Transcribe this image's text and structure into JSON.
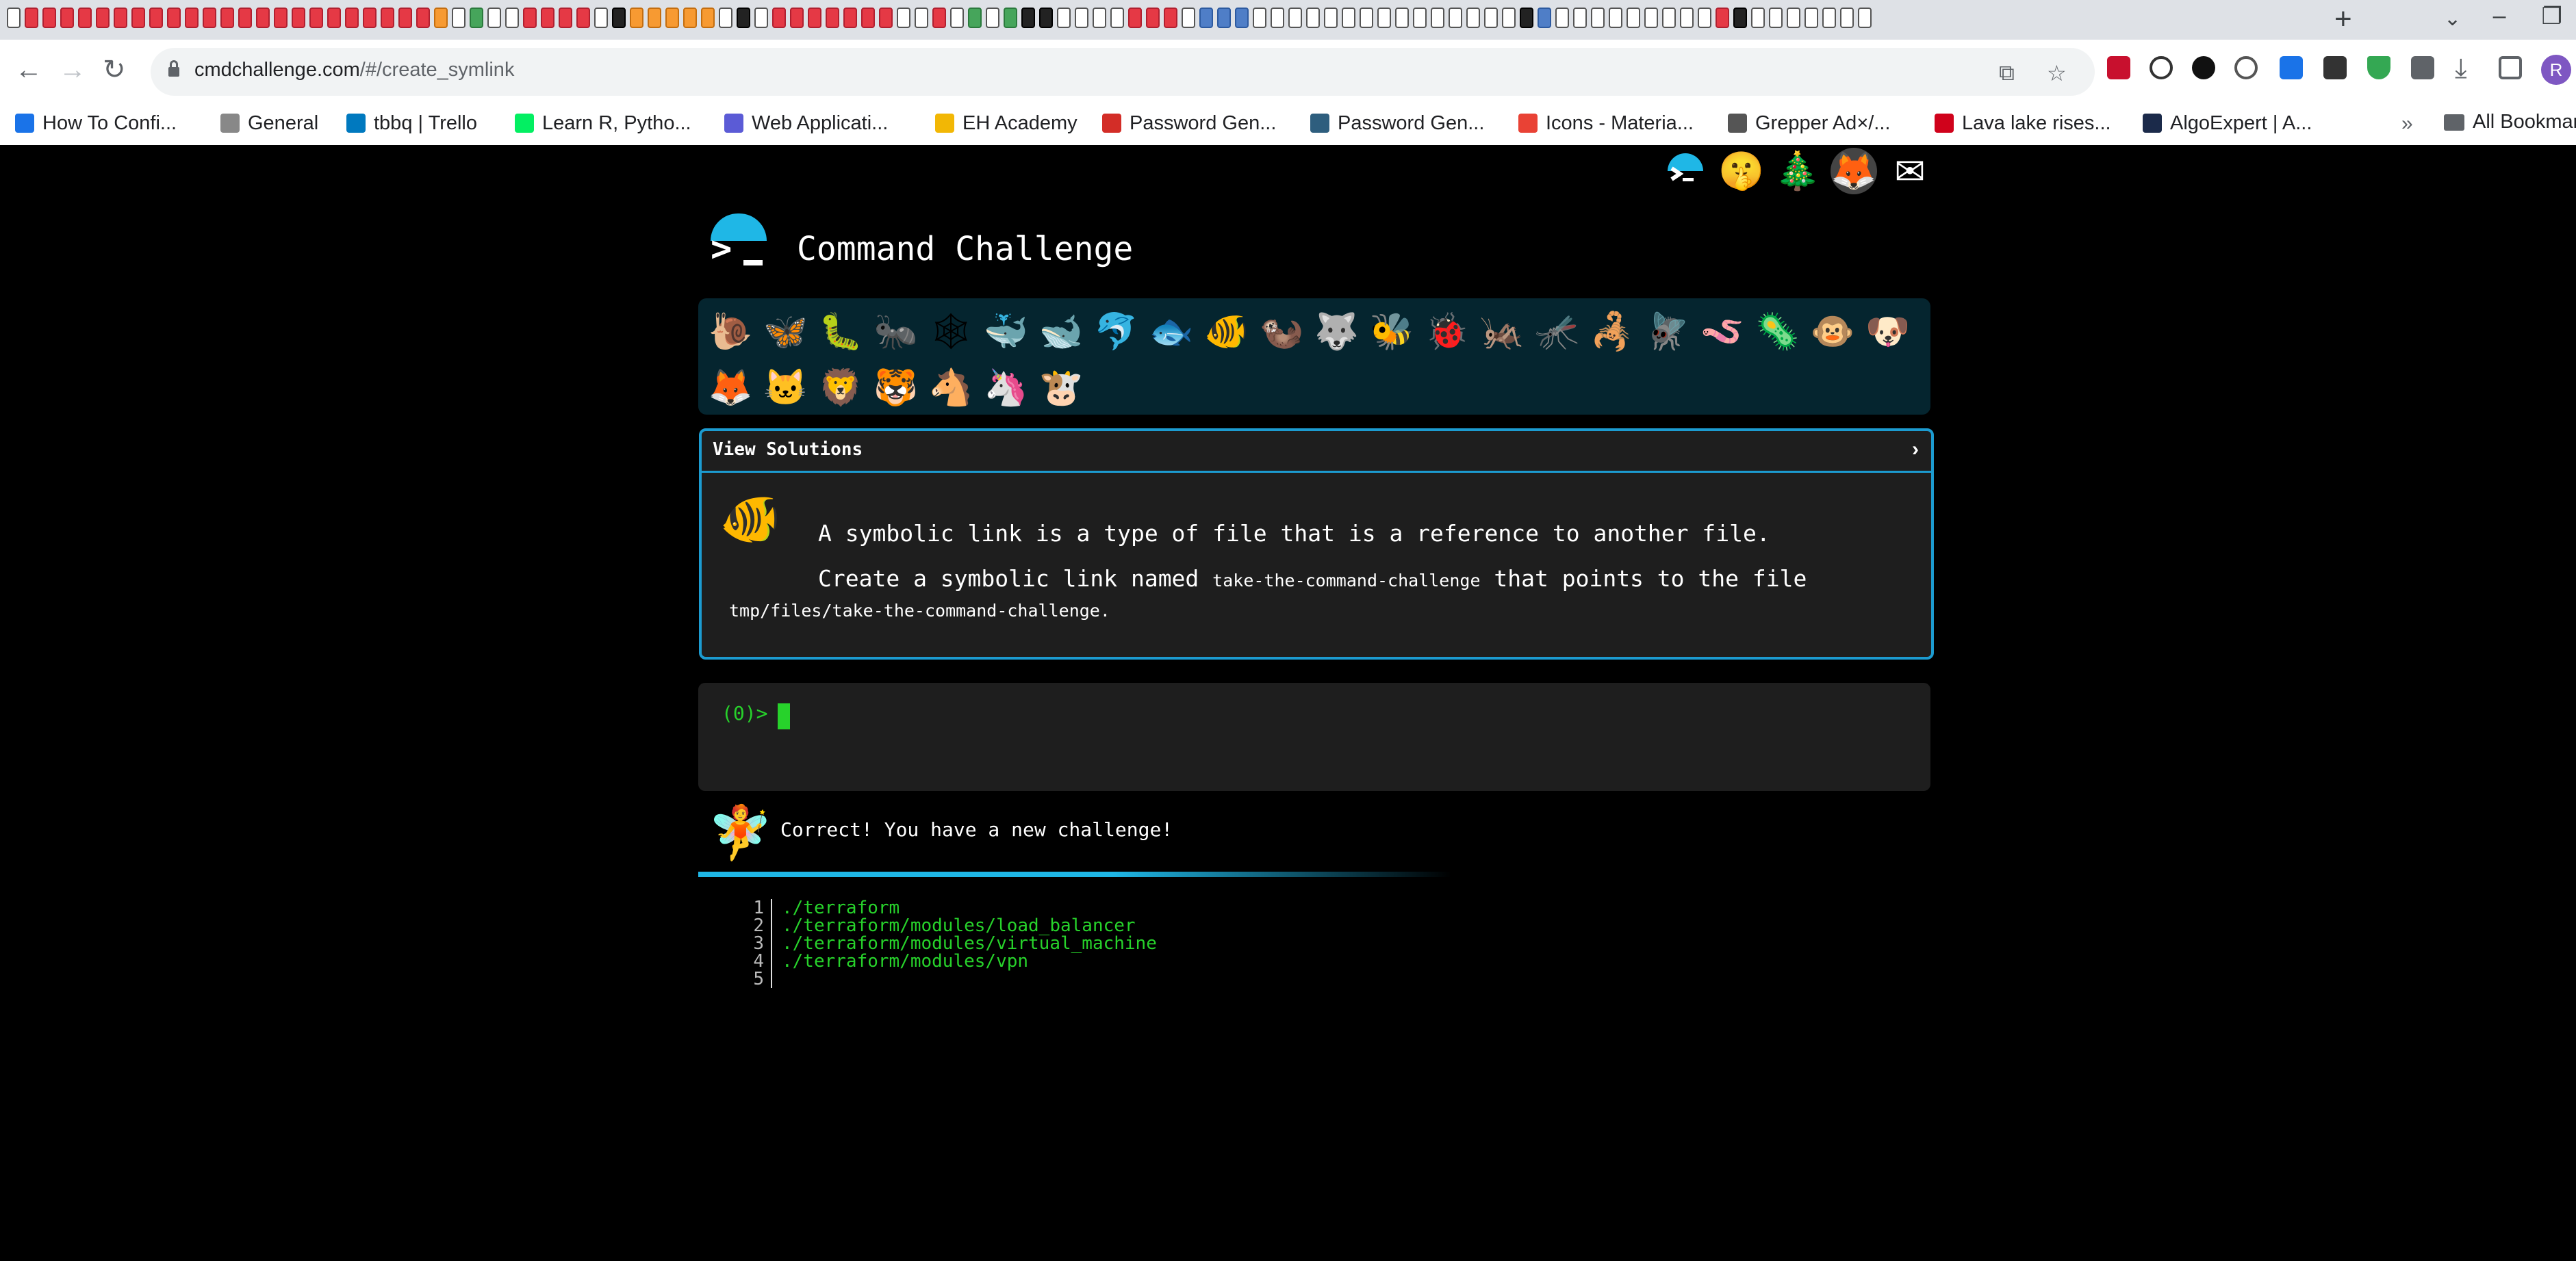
{
  "browser": {
    "url_host": "cmdchallenge.com",
    "url_path": "/#/create_symlink",
    "profile_initial": "R",
    "bookmarks": [
      {
        "label": "How To Confi...",
        "icon": "im-favicon",
        "color": "#1a73e8"
      },
      {
        "label": "General",
        "icon": "gears-favicon",
        "color": "#888888"
      },
      {
        "label": "tbbq | Trello",
        "icon": "trello-favicon",
        "color": "#0079bf"
      },
      {
        "label": "Learn R, Pytho...",
        "icon": "datacamp-favicon",
        "color": "#03ef62"
      },
      {
        "label": "Web Applicati...",
        "icon": "terminal-favicon",
        "color": "#5b5bd6"
      },
      {
        "label": "EH Academy",
        "icon": "eh-favicon",
        "color": "#f2b705"
      },
      {
        "label": "Password Gen...",
        "icon": "lastpass-favicon",
        "color": "#d32d27"
      },
      {
        "label": "Password Gen...",
        "icon": "bars-favicon",
        "color": "#2e5e7e"
      },
      {
        "label": "Icons - Materia...",
        "icon": "material-favicon",
        "color": "#e94235"
      },
      {
        "label": "Grepper Ad×/...",
        "icon": "globe-favicon",
        "color": "#555555"
      },
      {
        "label": "Lava lake rises...",
        "icon": "s-favicon",
        "color": "#d0021b"
      },
      {
        "label": "AlgoExpert | A...",
        "icon": "algo-favicon",
        "color": "#1b2a4a"
      }
    ],
    "all_bookmarks": "All Bookmarks",
    "more_bookmarks": "»"
  },
  "header": {
    "title": "Command Challenge"
  },
  "solutions": {
    "label": "View Solutions",
    "chevron": "›"
  },
  "challenge": {
    "line1": "A symbolic link is a type of file that is a reference to another file.",
    "line2_pre": "Create a symbolic link named ",
    "line2_code": "take-the-command-challenge",
    "line2_post": " that points to the file",
    "line3": "tmp/files/take-the-command-challenge."
  },
  "terminal": {
    "prompt": "(0)>"
  },
  "result": {
    "message": "Correct! You have a new challenge!",
    "progress": 0.55
  },
  "output": {
    "lines": [
      {
        "num": "1",
        "text": "./terraform"
      },
      {
        "num": "2",
        "text": "./terraform/modules/load_balancer"
      },
      {
        "num": "3",
        "text": "./terraform/modules/virtual_machine"
      },
      {
        "num": "4",
        "text": "./terraform/modules/vpn"
      },
      {
        "num": "5",
        "text": ""
      }
    ]
  }
}
